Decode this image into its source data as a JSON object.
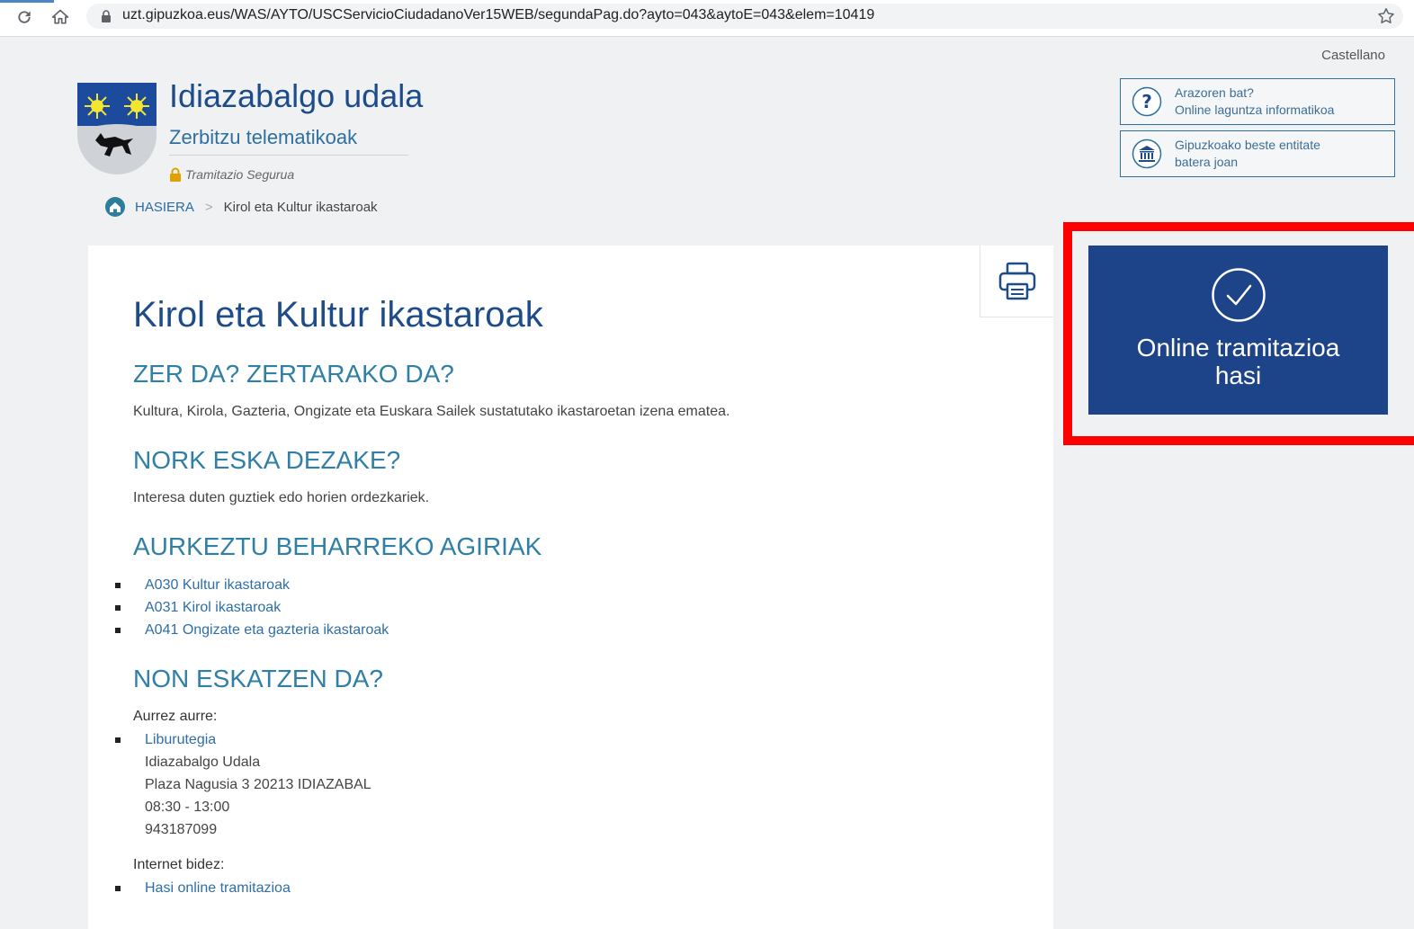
{
  "browser": {
    "url": "uzt.gipuzkoa.eus/WAS/AYTO/USCServicioCiudadanoVer15WEB/segundaPag.do?ayto=043&aytoE=043&elem=10419"
  },
  "header": {
    "language_link": "Castellano",
    "title": "Idiazabalgo udala",
    "subtitle": "Zerbitzu telematikoak",
    "secure_label": "Tramitazio Segurua",
    "breadcrumb": {
      "home": "HASIERA",
      "separator": ">",
      "current": "Kirol eta Kultur ikastaroak"
    },
    "help_links": [
      {
        "line1": "Arazoren bat?",
        "line2": "Online laguntza informatikoa",
        "icon": "question-icon"
      },
      {
        "line1": "Gipuzkoako beste entitate",
        "line2": "batera joan",
        "icon": "institution-icon"
      }
    ]
  },
  "main": {
    "title": "Kirol eta Kultur ikastaroak",
    "sections": {
      "what": {
        "heading": "ZER DA? ZERTARAKO DA?",
        "text": "Kultura, Kirola, Gazteria, Ongizate eta Euskara Sailek sustatutako ikastaroetan izena ematea."
      },
      "who": {
        "heading": "NORK ESKA DEZAKE?",
        "text": "Interesa duten guztiek edo horien ordezkariek."
      },
      "docs": {
        "heading": "AURKEZTU BEHARREKO AGIRIAK",
        "items": [
          "A030 Kultur ikastaroak",
          "A031 Kirol ikastaroak",
          "A041 Ongizate eta gazteria ikastaroak"
        ]
      },
      "where": {
        "heading": "NON ESKATZEN DA?",
        "in_person_label": "Aurrez aurre:",
        "office_link": "Liburutegia",
        "address_lines": [
          "Idiazabalgo Udala",
          "Plaza Nagusia 3 20213 IDIAZABAL",
          "08:30 - 13:00",
          "943187099"
        ],
        "online_label": "Internet bidez:",
        "online_link": "Hasi online tramitazioa"
      }
    }
  },
  "online_button": {
    "line1": "Online tramitazioa",
    "line2": "hasi"
  },
  "colors": {
    "primary": "#1d4488",
    "heading_teal": "#2f7fa6",
    "link": "#2e6ea8",
    "highlight": "#ff0000"
  }
}
